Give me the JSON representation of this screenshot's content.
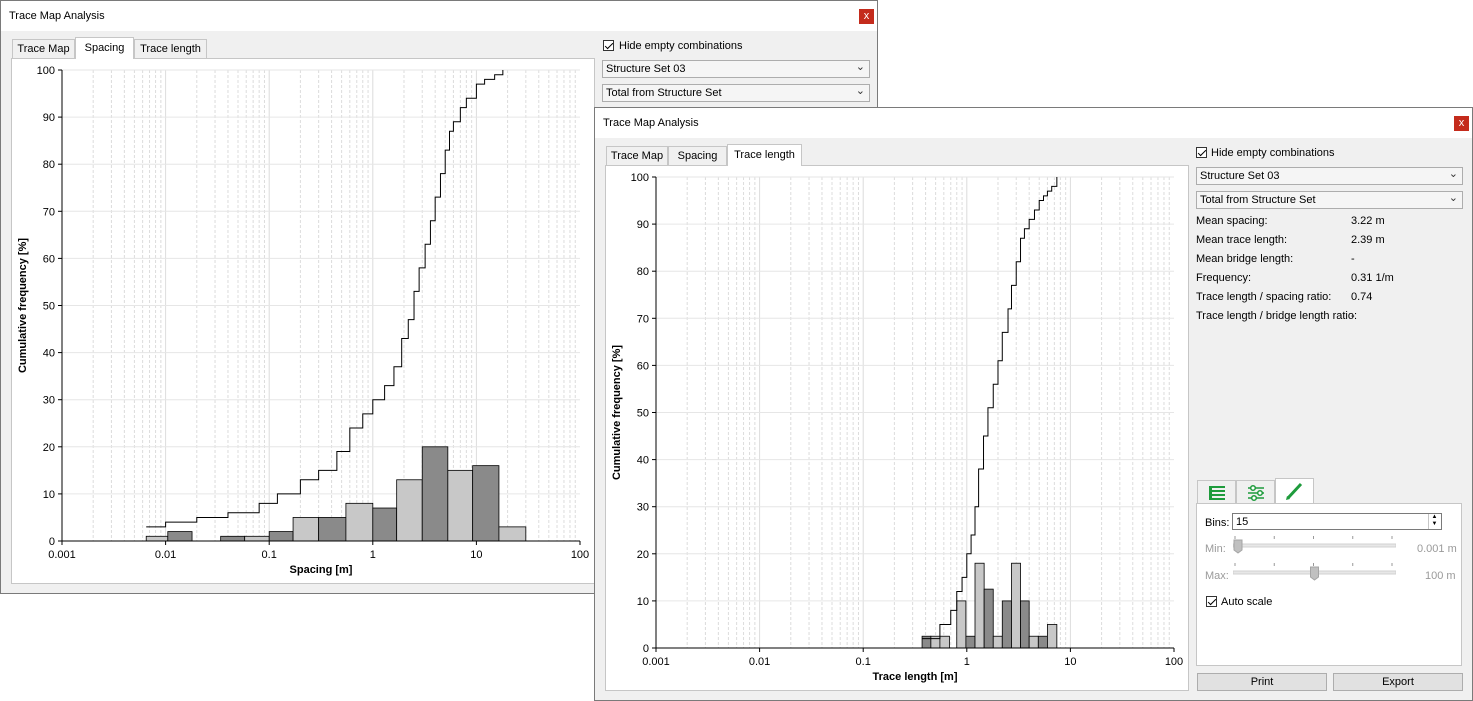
{
  "window_back": {
    "title": "Trace Map Analysis",
    "close": "x",
    "tabs": [
      "Trace Map",
      "Spacing",
      "Trace length"
    ],
    "active_tab": "Spacing",
    "hide_empty_label": "Hide empty combinations",
    "structure_set": "Structure Set 03",
    "total_option": "Total from Structure Set"
  },
  "window_front": {
    "title": "Trace Map Analysis",
    "close": "x",
    "tabs": [
      "Trace Map",
      "Spacing",
      "Trace length"
    ],
    "active_tab": "Trace length",
    "hide_empty_label": "Hide empty combinations",
    "structure_set": "Structure Set 03",
    "total_option": "Total from Structure Set",
    "stats": [
      {
        "label": "Mean spacing:",
        "value": "3.22 m"
      },
      {
        "label": "Mean trace length:",
        "value": "2.39 m"
      },
      {
        "label": "Mean bridge length:",
        "value": "-"
      },
      {
        "label": "Frequency:",
        "value": "0.31 1/m"
      },
      {
        "label": "Trace length / spacing ratio:",
        "value": "0.74"
      },
      {
        "label": "Trace length / bridge length ratio:",
        "value": "-"
      }
    ],
    "settings_tabs": [
      "table-icon",
      "sliders-icon",
      "pencil-icon"
    ],
    "bins_label": "Bins:",
    "bins_value": "15",
    "min_label": "Min:",
    "min_value": "0.001 m",
    "max_label": "Max:",
    "max_value": "100 m",
    "min_slider_fraction": 0.0,
    "max_slider_fraction": 0.5,
    "auto_scale_label": "Auto scale",
    "print_label": "Print",
    "export_label": "Export"
  },
  "colors": {
    "bar_light": "#c8c8c8",
    "bar_dark": "#8a8a8a",
    "close_red": "#c42b1c",
    "icon_green": "#1e9b3c"
  },
  "chart_data": [
    {
      "type": "bar",
      "xscale": "log",
      "xlim": [
        0.001,
        100
      ],
      "ylim": [
        0,
        100
      ],
      "xticks": [
        "0.001",
        "0.01",
        "0.1",
        "1",
        "10",
        "100"
      ],
      "yticks": [
        "0",
        "10",
        "20",
        "30",
        "40",
        "50",
        "60",
        "70",
        "80",
        "90",
        "100"
      ],
      "xlabel": "Spacing [m]",
      "ylabel": "Cumulative frequency [%]",
      "grid": true,
      "bars": [
        {
          "x0": 0.0065,
          "x1": 0.0105,
          "value": 1.0,
          "shade": "light"
        },
        {
          "x0": 0.0105,
          "x1": 0.018,
          "value": 2.0,
          "shade": "dark"
        },
        {
          "x0": 0.034,
          "x1": 0.058,
          "value": 1.0,
          "shade": "dark"
        },
        {
          "x0": 0.058,
          "x1": 0.1,
          "value": 1.0,
          "shade": "light"
        },
        {
          "x0": 0.1,
          "x1": 0.17,
          "value": 2.0,
          "shade": "dark"
        },
        {
          "x0": 0.17,
          "x1": 0.3,
          "value": 5.0,
          "shade": "light"
        },
        {
          "x0": 0.3,
          "x1": 0.55,
          "value": 5.0,
          "shade": "dark"
        },
        {
          "x0": 0.55,
          "x1": 1.0,
          "value": 8.0,
          "shade": "light"
        },
        {
          "x0": 1.0,
          "x1": 1.7,
          "value": 7.0,
          "shade": "dark"
        },
        {
          "x0": 1.7,
          "x1": 3.0,
          "value": 13.0,
          "shade": "light"
        },
        {
          "x0": 3.0,
          "x1": 5.3,
          "value": 20.0,
          "shade": "dark"
        },
        {
          "x0": 5.3,
          "x1": 9.2,
          "value": 15.0,
          "shade": "light"
        },
        {
          "x0": 9.2,
          "x1": 16.5,
          "value": 16.0,
          "shade": "dark"
        },
        {
          "x0": 16.5,
          "x1": 30.0,
          "value": 3.0,
          "shade": "light"
        }
      ],
      "cumulative": {
        "x": [
          0.0065,
          0.01,
          0.02,
          0.04,
          0.08,
          0.12,
          0.2,
          0.3,
          0.45,
          0.6,
          0.8,
          1.0,
          1.3,
          1.6,
          1.9,
          2.2,
          2.5,
          2.8,
          3.2,
          3.6,
          4.0,
          4.5,
          5.0,
          5.5,
          6.0,
          7.0,
          8.0,
          10.0,
          12.0,
          15.0,
          18.0
        ],
        "y": [
          3,
          4,
          5,
          6,
          8,
          10,
          13,
          15,
          19,
          24,
          27,
          30,
          33,
          37,
          43,
          47,
          53,
          58,
          63,
          68,
          73,
          78,
          83,
          87,
          89,
          92,
          94,
          97,
          98,
          99,
          100
        ]
      }
    },
    {
      "type": "bar",
      "xscale": "log",
      "xlim": [
        0.001,
        100
      ],
      "ylim": [
        0,
        100
      ],
      "xticks": [
        "0.001",
        "0.01",
        "0.1",
        "1",
        "10",
        "100"
      ],
      "yticks": [
        "0",
        "10",
        "20",
        "30",
        "40",
        "50",
        "60",
        "70",
        "80",
        "90",
        "100"
      ],
      "xlabel": "Trace length [m]",
      "ylabel": "Cumulative frequency [%]",
      "grid": true,
      "bars": [
        {
          "x0": 0.37,
          "x1": 0.45,
          "value": 2.5,
          "shade": "dark"
        },
        {
          "x0": 0.45,
          "x1": 0.55,
          "value": 2.5,
          "shade": "light"
        },
        {
          "x0": 0.55,
          "x1": 0.68,
          "value": 2.5,
          "shade": "light"
        },
        {
          "x0": 0.8,
          "x1": 0.98,
          "value": 10.0,
          "shade": "light"
        },
        {
          "x0": 0.98,
          "x1": 1.2,
          "value": 2.5,
          "shade": "dark"
        },
        {
          "x0": 1.2,
          "x1": 1.47,
          "value": 18.0,
          "shade": "light"
        },
        {
          "x0": 1.47,
          "x1": 1.8,
          "value": 12.5,
          "shade": "dark"
        },
        {
          "x0": 1.8,
          "x1": 2.2,
          "value": 2.5,
          "shade": "light"
        },
        {
          "x0": 2.2,
          "x1": 2.7,
          "value": 10.0,
          "shade": "dark"
        },
        {
          "x0": 2.7,
          "x1": 3.3,
          "value": 18.0,
          "shade": "light"
        },
        {
          "x0": 3.3,
          "x1": 4.0,
          "value": 10.0,
          "shade": "dark"
        },
        {
          "x0": 4.0,
          "x1": 4.9,
          "value": 2.5,
          "shade": "light"
        },
        {
          "x0": 4.9,
          "x1": 6.0,
          "value": 2.5,
          "shade": "dark"
        },
        {
          "x0": 6.0,
          "x1": 7.4,
          "value": 5.0,
          "shade": "light"
        }
      ],
      "cumulative": {
        "x": [
          0.37,
          0.55,
          0.7,
          0.8,
          0.9,
          1.0,
          1.1,
          1.2,
          1.3,
          1.45,
          1.6,
          1.8,
          2.0,
          2.2,
          2.5,
          2.7,
          3.0,
          3.3,
          3.6,
          4.0,
          4.5,
          5.0,
          5.5,
          6.0,
          6.6,
          7.4
        ],
        "y": [
          2,
          5,
          8,
          12,
          15,
          20,
          24,
          30,
          38,
          45,
          51,
          56,
          61,
          67,
          72,
          77,
          82,
          87,
          89,
          91,
          93,
          95,
          96,
          97,
          98,
          100
        ]
      }
    }
  ]
}
